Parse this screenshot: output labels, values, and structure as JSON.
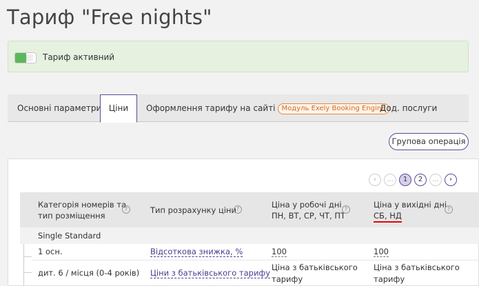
{
  "page": {
    "title": "Тариф \"Free nights\""
  },
  "status": {
    "label": "Тариф активний",
    "active": true,
    "accent": "#5cb85c"
  },
  "tabs": [
    {
      "label": "Основні параметри"
    },
    {
      "label": "Ціни"
    },
    {
      "label": "Оформлення тарифу на сайті",
      "badge": "Модуль Exely Booking Engine"
    },
    {
      "label": "Дод. послуги"
    }
  ],
  "actions": {
    "group_operation": "Групова операція"
  },
  "pagination": {
    "prev": "‹",
    "ellipsis": "...",
    "pages": [
      "1",
      "2"
    ],
    "next": "›",
    "current": "1"
  },
  "table": {
    "headers": {
      "category_line1": "Категорія номерів та",
      "category_line2": "тип розміщення",
      "calc_type": "Тип розрахунку ціни",
      "weekday_line1": "Ціна у робочі дні",
      "weekday_line2": "ПН, ВТ, СР, ЧТ, ПТ",
      "weekend_line1": "Ціна у вихідні дні",
      "weekend_line2": "СБ, НД"
    },
    "group": "Single Standard",
    "rows": [
      {
        "placement": "1 осн.",
        "calc": "Відсоткова знижка, %",
        "weekday": "100",
        "weekend": "100"
      },
      {
        "placement": "дит. 6 / місця (0-4 років)",
        "calc": "Ціни з батьківського тарифу",
        "weekday_line1": "Ціна з батьківського",
        "weekday_line2": "тарифу",
        "weekend_line1": "Ціна з батьківського",
        "weekend_line2": "тарифу"
      }
    ]
  },
  "colors": {
    "brand": "#5b4a9a",
    "highlight": "#e00000",
    "badge": "#e8883c"
  }
}
